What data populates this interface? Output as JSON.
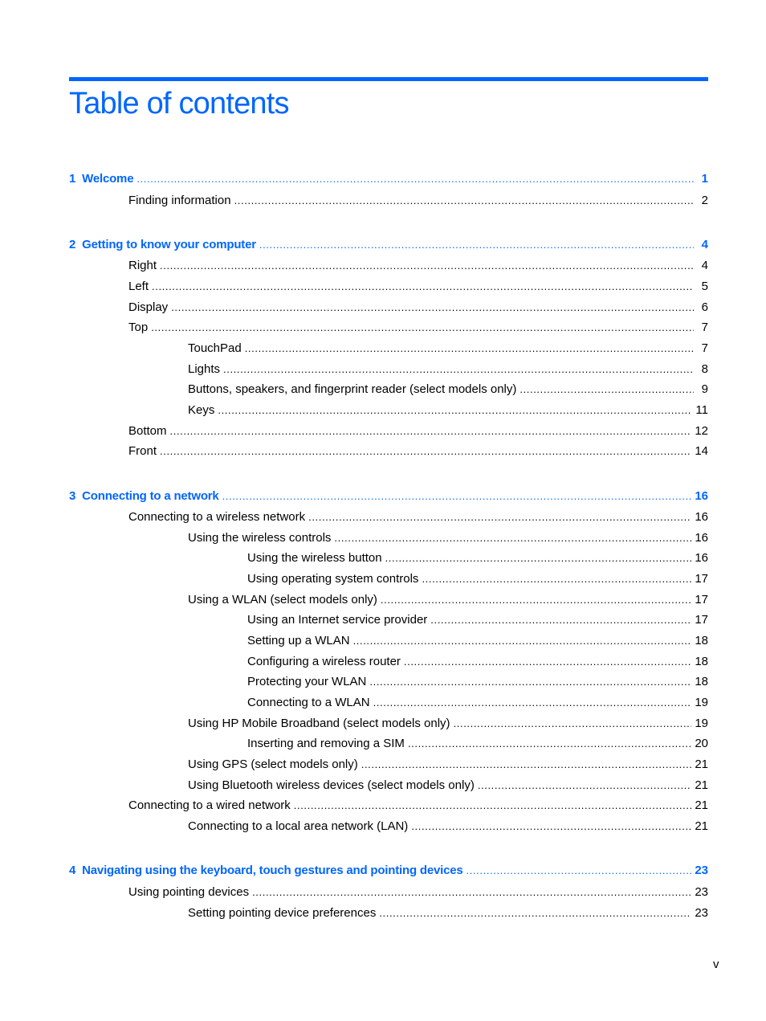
{
  "header": {
    "title": "Table of contents"
  },
  "colors": {
    "accent": "#0066ff",
    "text": "#000000"
  },
  "toc": [
    {
      "level": 0,
      "number": "1",
      "label": "Welcome",
      "page": "1"
    },
    {
      "level": 1,
      "label": "Finding information",
      "page": "2"
    },
    {
      "level": 0,
      "number": "2",
      "label": "Getting to know your computer",
      "page": "4"
    },
    {
      "level": 1,
      "label": "Right",
      "page": "4"
    },
    {
      "level": 1,
      "label": "Left",
      "page": "5"
    },
    {
      "level": 1,
      "label": "Display",
      "page": "6"
    },
    {
      "level": 1,
      "label": "Top",
      "page": "7"
    },
    {
      "level": 2,
      "label": "TouchPad",
      "page": "7"
    },
    {
      "level": 2,
      "label": "Lights",
      "page": "8"
    },
    {
      "level": 2,
      "label": "Buttons, speakers, and fingerprint reader (select models only)",
      "page": "9"
    },
    {
      "level": 2,
      "label": "Keys",
      "page": "11"
    },
    {
      "level": 1,
      "label": "Bottom",
      "page": "12"
    },
    {
      "level": 1,
      "label": "Front",
      "page": "14"
    },
    {
      "level": 0,
      "number": "3",
      "label": "Connecting to a network",
      "page": "16"
    },
    {
      "level": 1,
      "label": "Connecting to a wireless network",
      "page": "16"
    },
    {
      "level": 2,
      "label": "Using the wireless controls",
      "page": "16"
    },
    {
      "level": 3,
      "label": "Using the wireless button",
      "page": "16"
    },
    {
      "level": 3,
      "label": "Using operating system controls",
      "page": "17"
    },
    {
      "level": 2,
      "label": "Using a WLAN (select models only)",
      "page": "17"
    },
    {
      "level": 3,
      "label": "Using an Internet service provider",
      "page": "17"
    },
    {
      "level": 3,
      "label": "Setting up a WLAN",
      "page": "18"
    },
    {
      "level": 3,
      "label": "Configuring a wireless router",
      "page": "18"
    },
    {
      "level": 3,
      "label": "Protecting your WLAN",
      "page": "18"
    },
    {
      "level": 3,
      "label": "Connecting to a WLAN",
      "page": "19"
    },
    {
      "level": 2,
      "label": "Using HP Mobile Broadband (select models only)",
      "page": "19"
    },
    {
      "level": 3,
      "label": "Inserting and removing a SIM",
      "page": "20"
    },
    {
      "level": 2,
      "label": "Using GPS (select models only)",
      "page": "21"
    },
    {
      "level": 2,
      "label": "Using Bluetooth wireless devices (select models only)",
      "page": "21"
    },
    {
      "level": 1,
      "label": "Connecting to a wired network",
      "page": "21"
    },
    {
      "level": 2,
      "label": "Connecting to a local area network (LAN)",
      "page": "21"
    },
    {
      "level": 0,
      "number": "4",
      "label": "Navigating using the keyboard, touch gestures and pointing devices",
      "page": "23"
    },
    {
      "level": 1,
      "label": "Using pointing devices",
      "page": "23"
    },
    {
      "level": 2,
      "label": "Setting pointing device preferences",
      "page": "23"
    }
  ],
  "footer": {
    "folio": "v"
  }
}
